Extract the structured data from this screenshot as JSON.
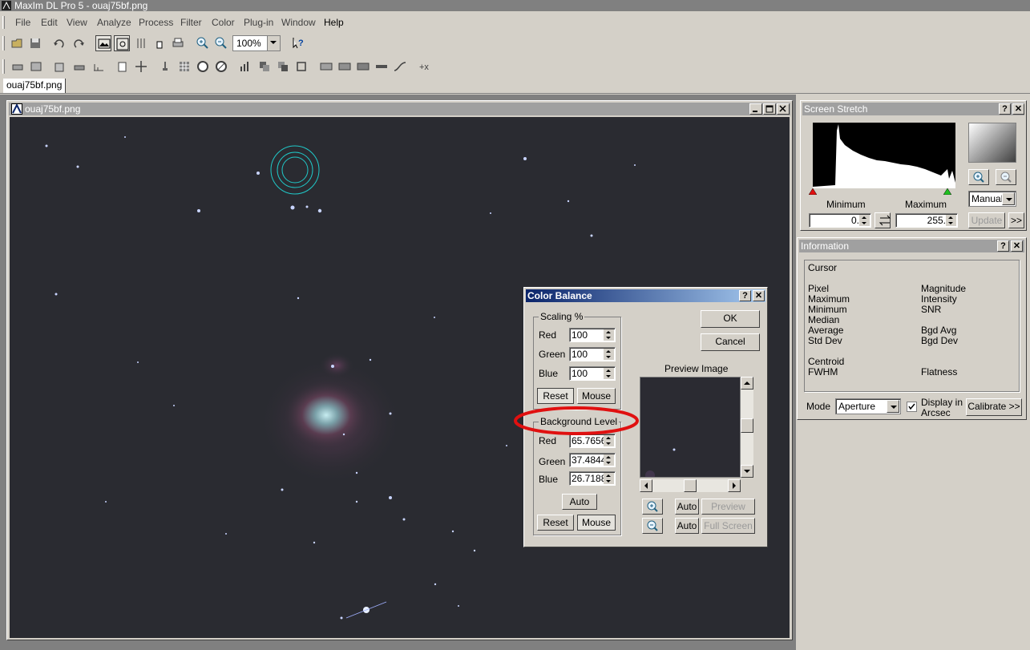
{
  "app": {
    "title": "MaxIm DL Pro 5 - ouaj75bf.png"
  },
  "menu": [
    "File",
    "Edit",
    "View",
    "Analyze",
    "Process",
    "Filter",
    "Color",
    "Plug-in",
    "Window",
    "Help"
  ],
  "toolbar": {
    "zoom": "100%",
    "icons_row1": [
      "open-icon",
      "save-icon",
      "undo-icon",
      "redo-icon",
      "full-frame-icon",
      "screen-stretch-icon",
      "color-balance-icon",
      "hand-icon",
      "print-icon",
      "zoom-in-icon",
      "zoom-out-icon",
      "context-help-icon"
    ],
    "icons_row2": [
      "crop-icon",
      "bin-icon",
      "stack-icon",
      "calibrate-icon",
      "measure-icon",
      "copy-icon",
      "crosshair-icon",
      "pin-icon",
      "grid-icon",
      "kernel-icon",
      "filter-icon",
      "bars-icon",
      "overlap-icon",
      "overlap2-icon",
      "square-icon",
      "stretch-icon",
      "rotate-icon",
      "flip-icon",
      "line-icon",
      "curve-icon",
      "plusminus-icon"
    ]
  },
  "tabs": [
    "ouaj75bf.png"
  ],
  "image_window": {
    "title": "ouaj75bf.png"
  },
  "color_balance": {
    "title": "Color Balance",
    "scaling_label": "Scaling %",
    "scaling": [
      {
        "label": "Red",
        "value": "100"
      },
      {
        "label": "Green",
        "value": "100"
      },
      {
        "label": "Blue",
        "value": "100"
      }
    ],
    "reset": "Reset",
    "mouse": "Mouse",
    "background_label": "Background Level",
    "background": [
      {
        "label": "Red",
        "value": "65.7656"
      },
      {
        "label": "Green",
        "value": "37.4844"
      },
      {
        "label": "Blue",
        "value": "26.7188"
      }
    ],
    "auto": "Auto",
    "ok": "OK",
    "cancel": "Cancel",
    "preview_label": "Preview Image",
    "preview": "Preview",
    "full_screen": "Full Screen"
  },
  "screen_stretch": {
    "title": "Screen Stretch",
    "min_label": "Minimum",
    "max_label": "Maximum",
    "min_value": "0.",
    "max_value": "255.",
    "mode": "Manual",
    "update": "Update",
    "more": ">>"
  },
  "information": {
    "title": "Information",
    "cursor": "Cursor",
    "left_labels": [
      "Pixel",
      "Maximum",
      "Minimum",
      "Median",
      "Average",
      "Std Dev"
    ],
    "right_labels": [
      "Magnitude",
      "Intensity",
      "SNR",
      "",
      "Bgd Avg",
      "Bgd Dev"
    ],
    "centroid": "Centroid",
    "fwhm": "FWHM",
    "flatness": "Flatness",
    "mode_label": "Mode",
    "mode_value": "Aperture",
    "display_arcsec": "Display in",
    "display_arcsec2": "Arcsec",
    "calibrate": "Calibrate >>"
  },
  "colors": {
    "active_title": "#0a246a",
    "inactive_title": "#a0a0a0",
    "annotation_ring": "#e01010",
    "aperture_ring": "#20c8c8",
    "sky": "#2a2b31"
  }
}
